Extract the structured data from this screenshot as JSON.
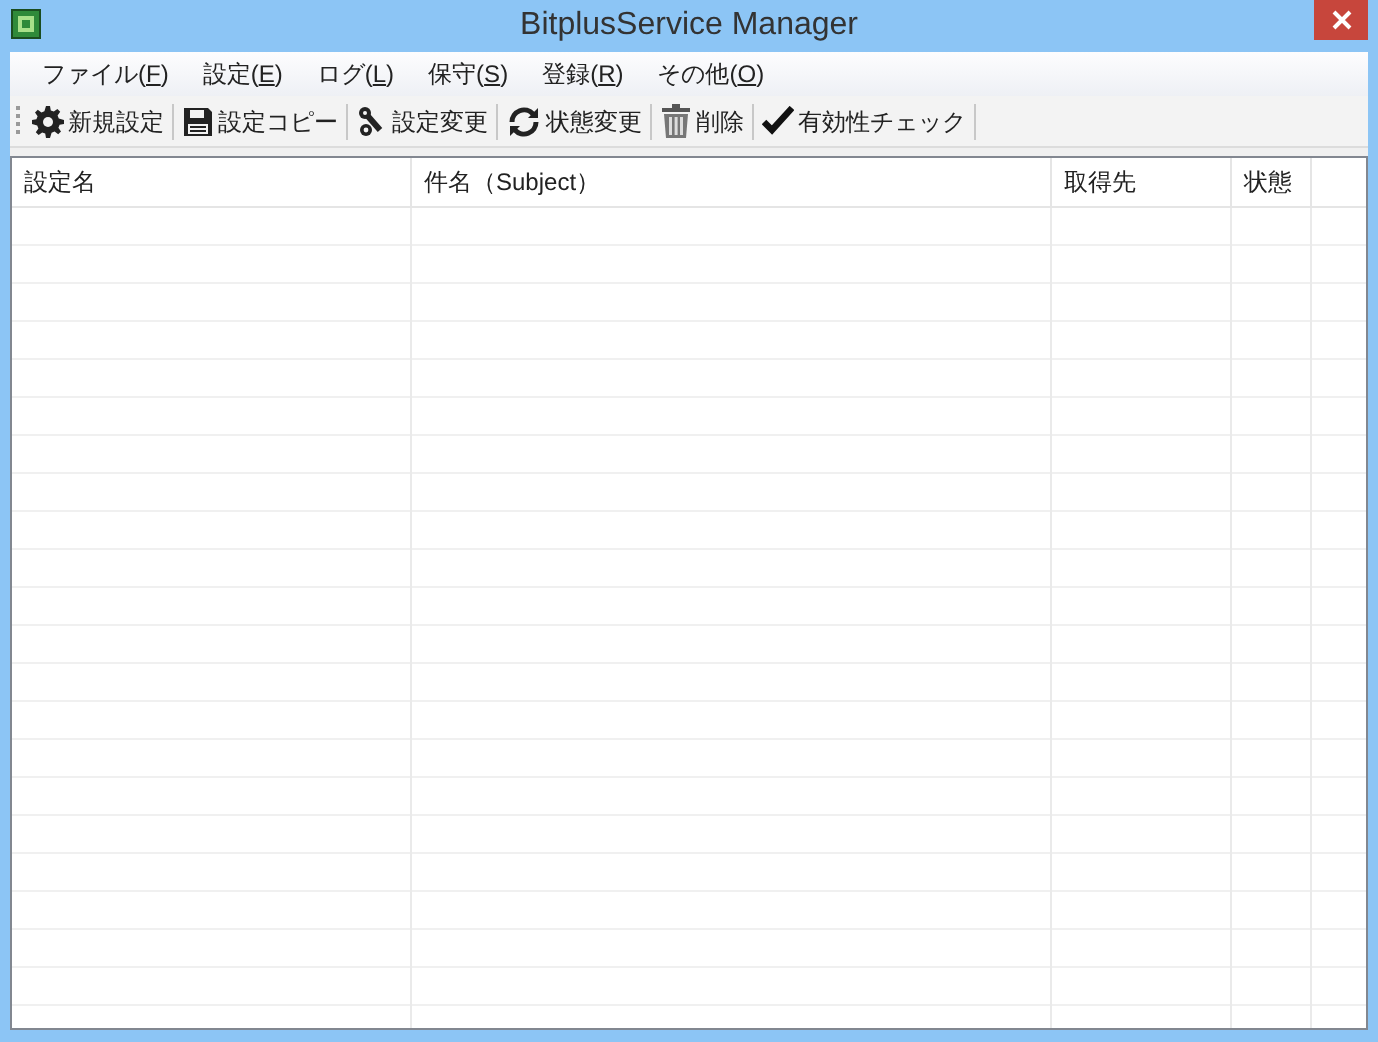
{
  "window": {
    "title": "BitplusService Manager"
  },
  "menu": [
    {
      "before": "ファイル(",
      "access_key": "F",
      "after": ")"
    },
    {
      "before": "設定(",
      "access_key": "E",
      "after": ")"
    },
    {
      "before": "ログ(",
      "access_key": "L",
      "after": ")"
    },
    {
      "before": "保守(",
      "access_key": "S",
      "after": ")"
    },
    {
      "before": "登録(",
      "access_key": "R",
      "after": ")"
    },
    {
      "before": "その他(",
      "access_key": "O",
      "after": ")"
    }
  ],
  "toolbar": [
    {
      "kind": "gear",
      "label": "新規設定"
    },
    {
      "kind": "floppy",
      "label": "設定コピー"
    },
    {
      "kind": "tools",
      "label": "設定変更"
    },
    {
      "kind": "refresh",
      "label": "状態変更"
    },
    {
      "kind": "trash",
      "label": "削除"
    },
    {
      "kind": "check",
      "label": "有効性チェック"
    }
  ],
  "table": {
    "columns": [
      "設定名",
      "件名（Subject）",
      "取得先",
      "状態"
    ]
  }
}
